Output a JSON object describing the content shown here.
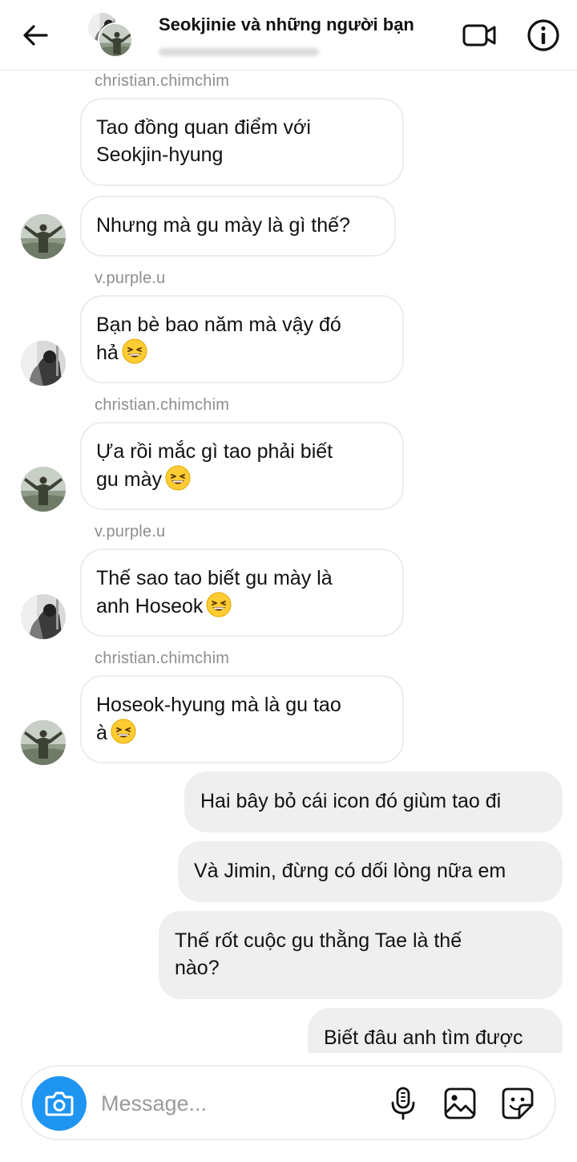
{
  "header": {
    "title": "Seokjinie và những người bạn",
    "back_icon": "arrow-left-icon",
    "video_icon": "video-camera-icon",
    "info_icon": "info-icon"
  },
  "thread": {
    "messages": [
      {
        "sender": "christian.chimchim",
        "text_lines": [
          "Tao đồng quan điểm với",
          "Seokjin-hyung"
        ]
      },
      {
        "text_lines": [
          "Nhưng mà gu mày là gì thế?"
        ],
        "avatar": "man-arms-open-avatar"
      },
      {
        "sender": "v.purple.u",
        "text_lines": [
          "Bạn bè bao năm mà vậy đó",
          "hả"
        ],
        "emoji": "grinning-squint-emoji",
        "avatar": "couple-bw-avatar"
      },
      {
        "sender": "christian.chimchim",
        "text_lines": [
          "Ựa rồi mắc gì tao phải biết",
          "gu mày"
        ],
        "emoji": "grinning-squint-emoji",
        "avatar": "man-arms-open-avatar"
      },
      {
        "sender": "v.purple.u",
        "text_lines": [
          "Thế sao tao biết gu mày là",
          "anh Hoseok"
        ],
        "emoji": "grinning-squint-emoji",
        "avatar": "couple-bw-avatar"
      },
      {
        "sender": "christian.chimchim",
        "text_lines": [
          "Hoseok-hyung mà là gu tao",
          "à"
        ],
        "emoji": "grinning-squint-emoji",
        "avatar": "man-arms-open-avatar"
      }
    ],
    "my_messages": [
      {
        "text_lines": [
          "Hai bây bỏ cái icon đó giùm tao đi"
        ]
      },
      {
        "text_lines": [
          "Và Jimin, đừng có dối lòng nữa em"
        ]
      },
      {
        "text_lines": [
          "Thế rốt cuộc gu thằng Tae là thế",
          "nào?"
        ]
      },
      {
        "text_lines": [
          "Biết đâu anh tìm được"
        ]
      }
    ]
  },
  "composer": {
    "placeholder": "Message...",
    "camera_icon": "camera-icon",
    "mic_icon": "microphone-icon",
    "gallery_icon": "image-gallery-icon",
    "sticker_icon": "sticker-icon"
  },
  "colors": {
    "accent": "#1f95f2",
    "my_bubble": "#efefef",
    "sender_gray": "#8e8e8e"
  }
}
